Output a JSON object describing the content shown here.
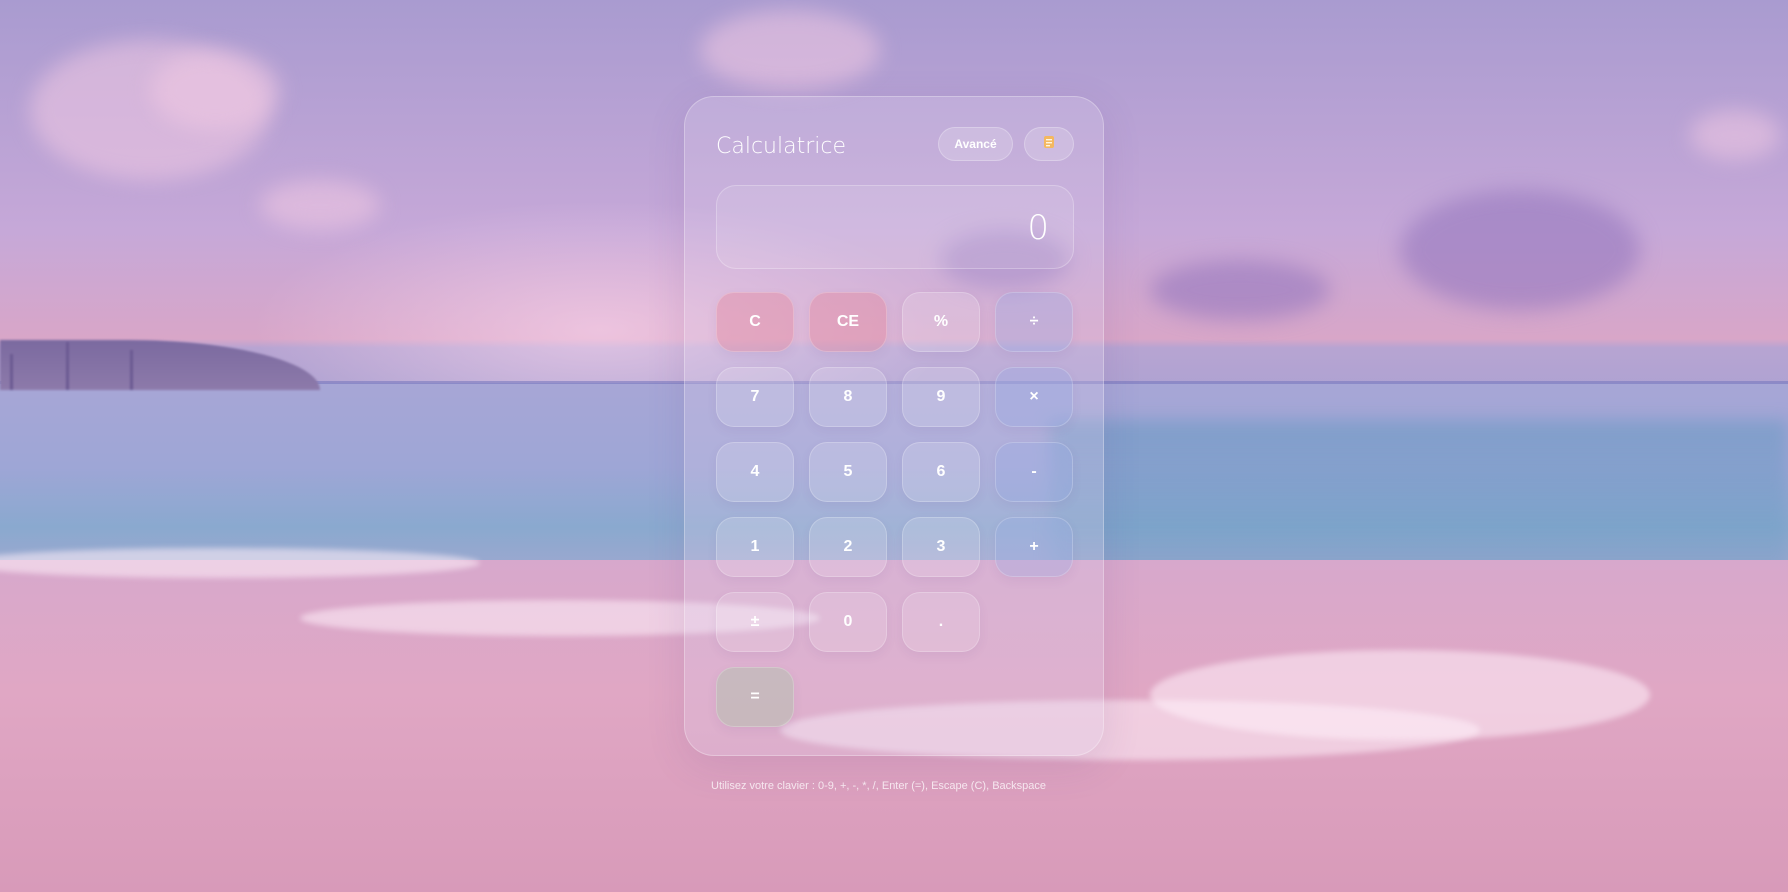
{
  "calculator": {
    "title": "Calculatrice",
    "advanced_label": "Avancé",
    "history_icon": "notepad-icon",
    "display_value": "0",
    "keys": {
      "clear": "C",
      "clear_entry": "CE",
      "percent": "%",
      "divide": "÷",
      "seven": "7",
      "eight": "8",
      "nine": "9",
      "multiply": "×",
      "four": "4",
      "five": "5",
      "six": "6",
      "subtract": "-",
      "one": "1",
      "two": "2",
      "three": "3",
      "add": "+",
      "plus_minus": "±",
      "zero": "0",
      "decimal": ".",
      "equals": "="
    },
    "keyboard_hint": "Utilisez votre clavier : 0-9, +, -, *, /, Enter (=), Escape (C), Backspace"
  },
  "colors": {
    "clear_key": "#e6829a",
    "operator_key": "#96aae6",
    "equals_key": "#a0c8a0",
    "text": "#ffffff"
  }
}
